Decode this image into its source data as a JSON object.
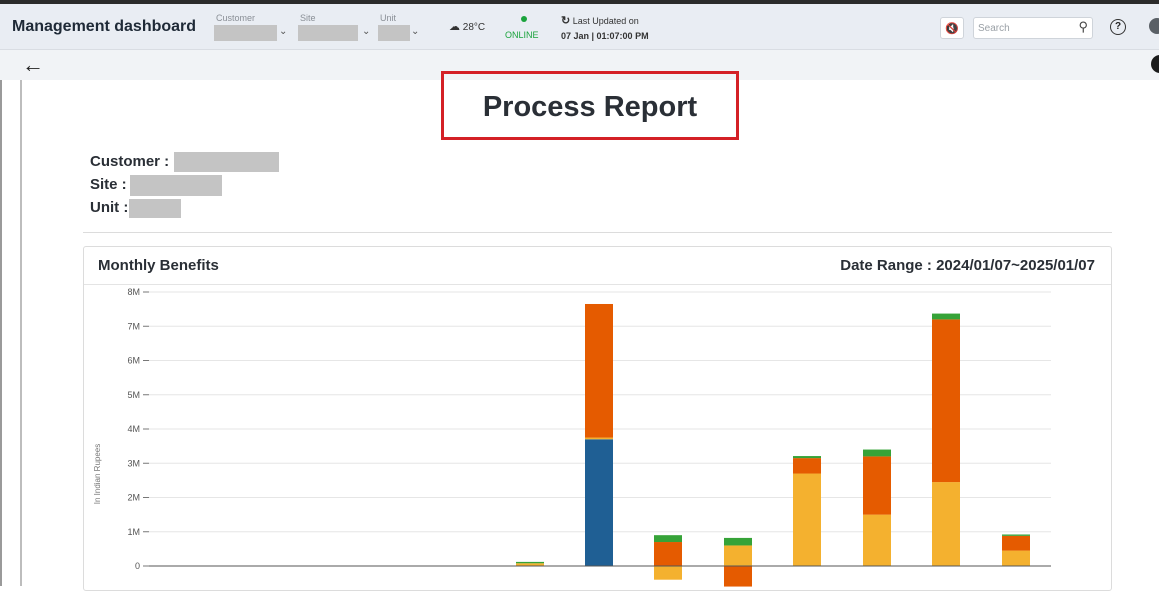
{
  "header": {
    "app_title": "Management dashboard",
    "filters": [
      {
        "label": "Customer"
      },
      {
        "label": "Site"
      },
      {
        "label": "Unit"
      }
    ],
    "weather": {
      "temperature": "28°C",
      "icon": "cloud-icon"
    },
    "status": {
      "text": "ONLINE",
      "color": "#1aa33c"
    },
    "last_updated": {
      "label": "Last Updated on",
      "value": "07 Jan | 01:07:00 PM"
    },
    "search": {
      "placeholder": "Search"
    }
  },
  "report": {
    "title": "Process Report",
    "customer_label": "Customer :",
    "site_label": "Site :",
    "unit_label": "Unit :"
  },
  "panel": {
    "title": "Monthly Benefits",
    "date_range": "Date Range : 2024/01/07~2025/01/07"
  },
  "colors": {
    "accent_red": "#d42026",
    "series": [
      "#1f5f94",
      "#f4b12f",
      "#e55b00",
      "#36a338"
    ]
  },
  "chart_data": {
    "type": "bar",
    "stacked": true,
    "ylabel": "In Indian Rupees",
    "ylim": [
      0,
      8000000
    ],
    "yticks": [
      "0",
      "1M",
      "2M",
      "3M",
      "4M",
      "5M",
      "6M",
      "7M",
      "8M"
    ],
    "grid": true,
    "bars": [
      {
        "segments": [
          {
            "color": "#f4b12f",
            "value": 80000
          },
          {
            "color": "#36a338",
            "value": 40000
          }
        ]
      },
      {
        "segments": [
          {
            "color": "#1f5f94",
            "value": 3700000
          },
          {
            "color": "#f4b12f",
            "value": 50000
          },
          {
            "color": "#e55b00",
            "value": 3900000
          }
        ]
      },
      {
        "segments": [
          {
            "color": "#f4b12f",
            "value": -400000
          },
          {
            "color": "#e55b00",
            "value": 700000
          },
          {
            "color": "#36a338",
            "value": 200000
          }
        ]
      },
      {
        "segments": [
          {
            "color": "#e55b00",
            "value": -600000
          },
          {
            "color": "#f4b12f",
            "value": 600000
          },
          {
            "color": "#36a338",
            "value": 220000
          }
        ]
      },
      {
        "segments": [
          {
            "color": "#f4b12f",
            "value": 2700000
          },
          {
            "color": "#e55b00",
            "value": 450000
          },
          {
            "color": "#36a338",
            "value": 60000
          }
        ]
      },
      {
        "segments": [
          {
            "color": "#f4b12f",
            "value": 1500000
          },
          {
            "color": "#e55b00",
            "value": 1700000
          },
          {
            "color": "#36a338",
            "value": 200000
          }
        ]
      },
      {
        "segments": [
          {
            "color": "#f4b12f",
            "value": 2450000
          },
          {
            "color": "#e55b00",
            "value": 4750000
          },
          {
            "color": "#36a338",
            "value": 170000
          }
        ]
      },
      {
        "segments": [
          {
            "color": "#f4b12f",
            "value": 450000
          },
          {
            "color": "#e55b00",
            "value": 430000
          },
          {
            "color": "#36a338",
            "value": 40000
          }
        ]
      }
    ]
  }
}
